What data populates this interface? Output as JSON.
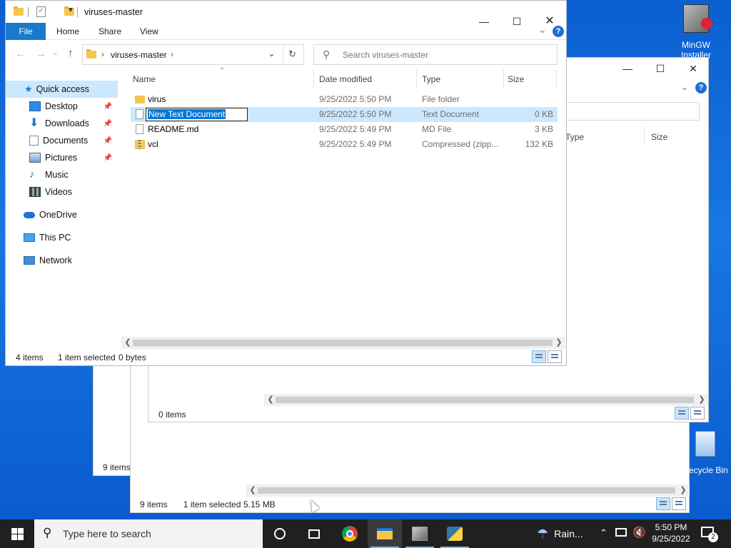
{
  "desktop": {
    "icons": [
      {
        "label": "MinGW Installer"
      },
      {
        "label": "Recycle Bin"
      }
    ]
  },
  "bg_window_outer": {
    "status_items": "9 items",
    "status_selected": "1 item selected",
    "status_size": "5.15 MB"
  },
  "bg_window_left": {
    "status_items": "9 items"
  },
  "bg_window_mid": {
    "col_type": "Type",
    "col_size": "Size",
    "status_items": "0 items"
  },
  "explorer": {
    "title": "viruses-master",
    "ribbon_tabs": [
      "File",
      "Home",
      "Share",
      "View"
    ],
    "address_path": "viruses-master",
    "search_placeholder": "Search viruses-master",
    "columns": {
      "name": "Name",
      "date": "Date modified",
      "type": "Type",
      "size": "Size"
    },
    "nav": {
      "quick_access": "Quick access",
      "items": [
        {
          "label": "Desktop",
          "icon": "desktop-icon"
        },
        {
          "label": "Downloads",
          "icon": "downloads-icon"
        },
        {
          "label": "Documents",
          "icon": "documents-icon"
        },
        {
          "label": "Pictures",
          "icon": "pictures-icon"
        },
        {
          "label": "Music",
          "icon": "music-icon"
        },
        {
          "label": "Videos",
          "icon": "videos-icon"
        }
      ],
      "onedrive": "OneDrive",
      "thispc": "This PC",
      "network": "Network"
    },
    "files": [
      {
        "name": "virus",
        "date": "9/25/2022 5:50 PM",
        "type": "File folder",
        "size": "",
        "icon": "folder-icon"
      },
      {
        "name": "New Text Document",
        "date": "9/25/2022 5:50 PM",
        "type": "Text Document",
        "size": "0 KB",
        "icon": "text-file-icon"
      },
      {
        "name": "README.md",
        "date": "9/25/2022 5:49 PM",
        "type": "MD File",
        "size": "3 KB",
        "icon": "text-file-icon"
      },
      {
        "name": "vcl",
        "date": "9/25/2022 5:49 PM",
        "type": "Compressed (zipp...",
        "size": "132 KB",
        "icon": "zip-folder-icon"
      }
    ],
    "status": {
      "items": "4 items",
      "selected": "1 item selected",
      "size": "0 bytes"
    }
  },
  "taskbar": {
    "search_placeholder": "Type here to search",
    "weather": "Rain...",
    "time": "5:50 PM",
    "date": "9/25/2022",
    "notification_count": "2"
  },
  "colors": {
    "accent": "#0078d7",
    "selection": "#cce8ff",
    "taskbar": "#202020"
  }
}
